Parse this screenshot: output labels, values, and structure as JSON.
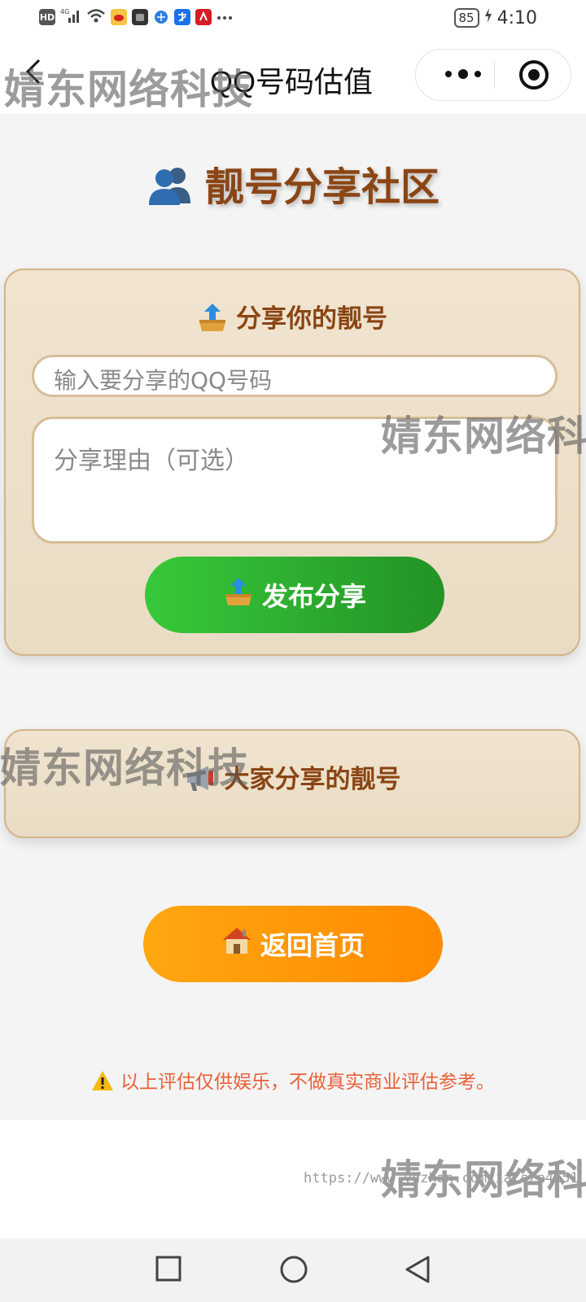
{
  "status_bar": {
    "left_icons": [
      "hd-icon",
      "signal-4g-icon",
      "wifi-icon",
      "weibo-icon",
      "app-icon",
      "browser-icon",
      "alipay-icon",
      "app-red-icon",
      "more-dots-icon"
    ],
    "network_label": "HD",
    "battery": "85",
    "time": "4:10"
  },
  "navbar": {
    "title": "QQ号码估值"
  },
  "community": {
    "title": "靓号分享社区",
    "icon": "users-icon"
  },
  "share_form": {
    "title": "分享你的靓号",
    "qq_placeholder": "输入要分享的QQ号码",
    "reason_placeholder": "分享理由（可选）",
    "publish_label": "发布分享"
  },
  "shared_list": {
    "title": "大家分享的靓号"
  },
  "home_button": {
    "label": "返回首页"
  },
  "disclaimer": {
    "text": "以上评估仅供娱乐，不做真实商业评估参考。"
  },
  "watermark": {
    "text": "婧东网络科技",
    "url": "https://www.ydzhan.com/iats/p4151"
  },
  "colors": {
    "title_brown": "#8b4513",
    "green_button": "#2db32f",
    "orange_button": "#ff9a00",
    "disclaimer": "#e8613a",
    "card_bg": "#ece0ca"
  }
}
